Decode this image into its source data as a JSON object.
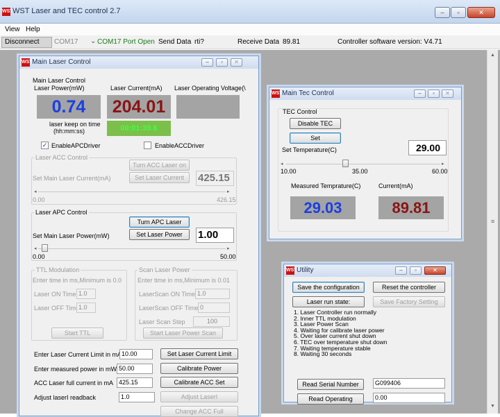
{
  "app": {
    "title": "WST Laser and TEC control 2.7",
    "logo": "WST"
  },
  "menu": [
    "View",
    "Help"
  ],
  "toolbar": {
    "disconnect": "Disconnect",
    "port": "COM17",
    "port_status": "COM17 Port Open",
    "send_label": "Send Data",
    "send_value": "rti?",
    "receive_label": "Receive Data",
    "receive_value": "89.81",
    "version": "Controller software version: V4.71"
  },
  "laser": {
    "title": "Main Laser Control",
    "section": "Main Laser Control",
    "power_label": "Laser Power(mW)",
    "current_label": "Laser Current(mA)",
    "voltage_label": "Laser Operating Voltage(\\",
    "power_value": "0.74",
    "current_value": "204.01",
    "voltage_value": "",
    "keep_label1": "laser keep on time",
    "keep_label2": "(hh:mm:ss)",
    "keep_value": "00:01:39.6",
    "apc_driver": "EnableAPCDriver",
    "acc_driver": "EnableACCDriver",
    "acc_group": "Laser ACC Control",
    "turn_acc": "Turn ACC Laser on",
    "set_current_label": "Set Main Laser Current(mA)",
    "set_current_btn": "Set Laser Current",
    "acc_value": "425.15",
    "acc_min": "0.00",
    "acc_max": "426.15",
    "apc_group": "Laser APC Control",
    "turn_apc": "Turn APC Laser",
    "set_power_label": "Set Main Laser Power(mW)",
    "set_power_btn": "Set Laser Power",
    "apc_value": "1.00",
    "apc_min": "0.00",
    "apc_max": "50.00",
    "ttl_group": "TTL Modulation",
    "ttl_hint": "Enter time in ms,Minimum is 0.0",
    "on_time_label": "Laser ON Time",
    "on_time": "1.0",
    "off_time_label": "Laser OFF Time",
    "off_time": "1.0",
    "start_ttl": "Start TTL",
    "scan_group": "Scan Laser Power",
    "scan_hint": "Enter time in ms,Minimum is 0.01",
    "scan_on_label": "LaserScan ON Time",
    "scan_on": "1.0",
    "scan_off_label": "LaserScan OFF Time",
    "scan_off": "0",
    "scan_step_label": "Laser Scan Step",
    "scan_step": "100",
    "start_scan": "Start Laser Power Scan",
    "limit_label": "Enter Laser Current Limit in mA",
    "limit_value": "10.00",
    "limit_btn": "Set Laser Current Limit",
    "measured_label": "Enter measured power in mW",
    "measured_value": "50.00",
    "calibrate_power": "Calibrate Power",
    "full_label": "ACC Laser full current in mA",
    "full_value": "425.15",
    "calibrate_acc": "Calibrate ACC Set",
    "adjust_label": "Adjust laserI readback",
    "adjust_value": "1.0",
    "adjust_btn": "Adjust LaserI",
    "change_acc": "Change ACC Full"
  },
  "tec": {
    "title": "Main Tec Control",
    "section": "TEC Control",
    "disable": "Disable TEC",
    "set": "Set",
    "set_temp_label": "Set Temperature(C)",
    "set_temp": "29.00",
    "min": "10.00",
    "mid": "35.00",
    "max": "60.00",
    "measured_label": "Measured Temprature(C)",
    "current_label": "Current(mA)",
    "measured": "29.03",
    "current": "89.81"
  },
  "utility": {
    "title": "Utility",
    "save": "Save the configuration",
    "reset": "Reset the controller",
    "run_state": "Laser run state:",
    "factory": "Save Factory Setting",
    "states": [
      "1. Laser Controller run normally",
      "2. Inner TTL modulation",
      "3. Laser Power Scan",
      "4. Waiting for calibrate laser power",
      "5. Over laser current shut down",
      "6. TEC over temperature shut down",
      "7. Waiting temperature stable",
      "8. Waiting 30 seconds"
    ],
    "serial_btn": "Read Serial Number",
    "serial": "G099406",
    "operating_btn": "Read Operating",
    "operating": "0.00"
  },
  "colors": {
    "blue": "#1b3fe0",
    "red": "#8a1414",
    "green": "#40ff40",
    "green_bg": "#7cbf4a"
  }
}
